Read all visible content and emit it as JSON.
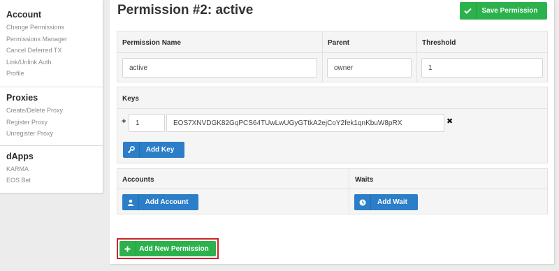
{
  "sidebar": {
    "account": {
      "heading": "Account",
      "items": [
        "Change Permissions",
        "Permissions Manager",
        "Cancel Deferred TX",
        "Link/Unlink Auth",
        "Profile"
      ]
    },
    "proxies": {
      "heading": "Proxies",
      "items": [
        "Create/Delete Proxy",
        "Register Proxy",
        "Unregister Proxy"
      ]
    },
    "dapps": {
      "heading": "dApps",
      "items": [
        "KARMA",
        "EOS Bet"
      ]
    }
  },
  "main": {
    "title": "Permission #2: active",
    "save_label": "Save Permission",
    "permission": {
      "name_header": "Permission Name",
      "parent_header": "Parent",
      "threshold_header": "Threshold",
      "name_value": "active",
      "parent_value": "owner",
      "threshold_value": "1"
    },
    "keys": {
      "header": "Keys",
      "plus_symbol": "+",
      "weight": "1",
      "key": "EOS7XNVDGK82GqPCS64TUwLwUGyGTtkA2ejCoY2fek1qnKbuW8pRX",
      "remove_symbol": "✖",
      "add_label": "Add Key"
    },
    "accounts": {
      "header": "Accounts",
      "add_label": "Add Account"
    },
    "waits": {
      "header": "Waits",
      "add_label": "Add Wait"
    },
    "add_permission_label": "Add New Permission",
    "colors": {
      "green": "#2bb24c",
      "blue": "#2b7ec7",
      "highlight": "#d0222a"
    }
  }
}
